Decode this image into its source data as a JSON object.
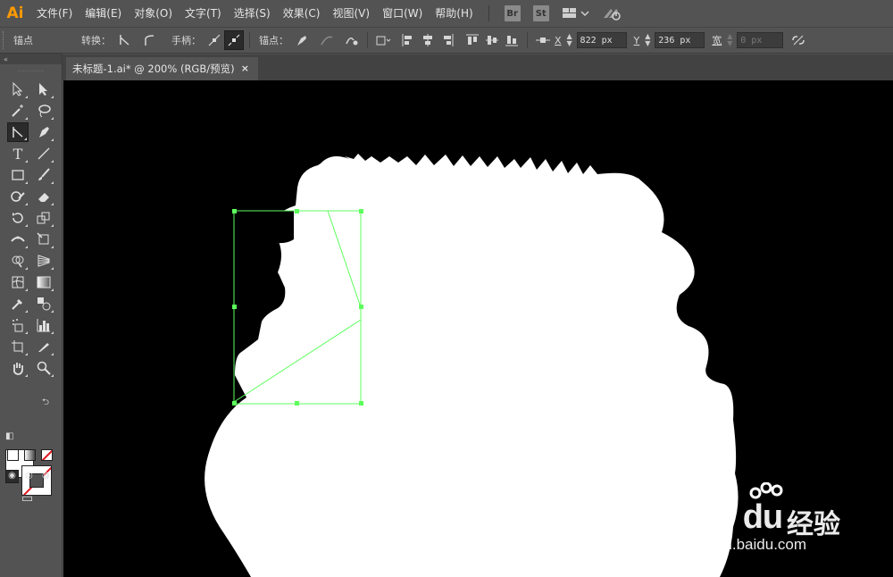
{
  "app": {
    "logo_text": "Ai"
  },
  "menu": {
    "items": [
      "文件(F)",
      "编辑(E)",
      "对象(O)",
      "文字(T)",
      "选择(S)",
      "效果(C)",
      "视图(V)",
      "窗口(W)",
      "帮助(H)"
    ],
    "bridge_badge": "Br",
    "stock_badge": "St"
  },
  "control_bar": {
    "panel_title": "锚点",
    "convert_label": "转换：",
    "handles_label": "手柄：",
    "anchor_label": "锚点：",
    "x_label": "X",
    "x_value": "822 px",
    "y_label": "Y",
    "y_value": "236 px",
    "width_label": "宽",
    "width_value": "0 px"
  },
  "toolbar": {
    "tools": [
      "selection-tool",
      "direct-selection-tool",
      "magic-wand-tool",
      "lasso-tool",
      "anchor-point-tool",
      "pen-tool",
      "type-tool",
      "line-segment-tool",
      "rectangle-tool",
      "paintbrush-tool",
      "shaper-tool",
      "eraser-tool",
      "rotate-tool",
      "scale-tool",
      "width-tool",
      "free-transform-tool",
      "shape-builder-tool",
      "perspective-grid-tool",
      "mesh-tool",
      "gradient-tool",
      "eyedropper-tool",
      "blend-tool",
      "symbol-sprayer-tool",
      "column-graph-tool",
      "artboard-tool",
      "slice-tool",
      "hand-tool",
      "zoom-tool"
    ],
    "fill_color": "#ffffff",
    "stroke": "none"
  },
  "document": {
    "tab_title": "未标题-1.ai* @ 200% (RGB/预览)",
    "tab_close": "×"
  },
  "canvas": {
    "background": "#000000",
    "shape_color": "#ffffff",
    "selection_color": "#5cff5c"
  },
  "watermark": {
    "brand": "Bai du",
    "cn": "经验",
    "url": "jingyan.baidu.com"
  }
}
